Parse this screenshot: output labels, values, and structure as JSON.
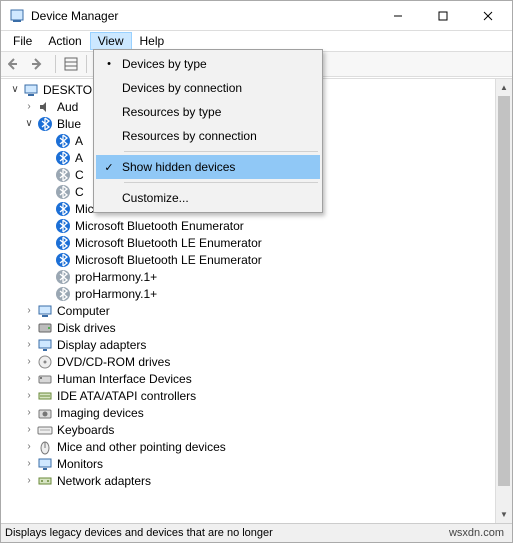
{
  "window": {
    "title": "Device Manager"
  },
  "menubar": {
    "file": "File",
    "action": "Action",
    "view": "View",
    "help": "Help"
  },
  "view_menu": {
    "items": [
      {
        "label": "Devices by type",
        "mark": "dot"
      },
      {
        "label": "Devices by connection",
        "mark": ""
      },
      {
        "label": "Resources by type",
        "mark": ""
      },
      {
        "label": "Resources by connection",
        "mark": ""
      }
    ],
    "show_hidden": "Show hidden devices",
    "show_hidden_mark": "check",
    "customize": "Customize..."
  },
  "tree": {
    "root": "DESKTO",
    "bt_aud": "Aud",
    "bt_blue": "Blue",
    "bt_items": [
      "A",
      "A",
      "C",
      "C",
      "Microsoft Bluetooth Enumerator",
      "Microsoft Bluetooth Enumerator",
      "Microsoft Bluetooth LE Enumerator",
      "Microsoft Bluetooth LE Enumerator",
      "proHarmony.1+",
      "proHarmony.1+"
    ],
    "cats": [
      "Computer",
      "Disk drives",
      "Display adapters",
      "DVD/CD-ROM drives",
      "Human Interface Devices",
      "IDE ATA/ATAPI controllers",
      "Imaging devices",
      "Keyboards",
      "Mice and other pointing devices",
      "Monitors",
      "Network adapters"
    ]
  },
  "status": {
    "left": "Displays legacy devices and devices that are no longer",
    "right": "wsxdn.com"
  }
}
